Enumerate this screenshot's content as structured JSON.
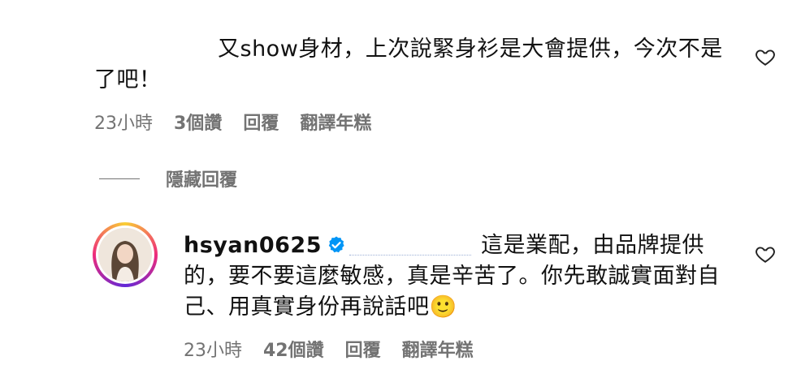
{
  "comment1": {
    "text": "又show身材，上次說緊身衫是大會提供，今次不是了吧！",
    "time": "23小時",
    "likes": "3個讚",
    "reply": "回覆",
    "translate": "翻譯年糕"
  },
  "hidden_replies": {
    "label": "隱藏回覆"
  },
  "comment2": {
    "username": "hsyan0625",
    "text": "這是業配，由品牌提供的，要不要這麼敏感，真是辛苦了。你先敢誠實面對自己、用真實身份再說話吧🙂",
    "time": "23小時",
    "likes": "42個讚",
    "reply": "回覆",
    "translate": "翻譯年糕"
  },
  "icons": {
    "like": "heart-icon",
    "verified": "verified-badge-icon"
  },
  "colors": {
    "meta": "#737373",
    "verified": "#0095f6"
  }
}
